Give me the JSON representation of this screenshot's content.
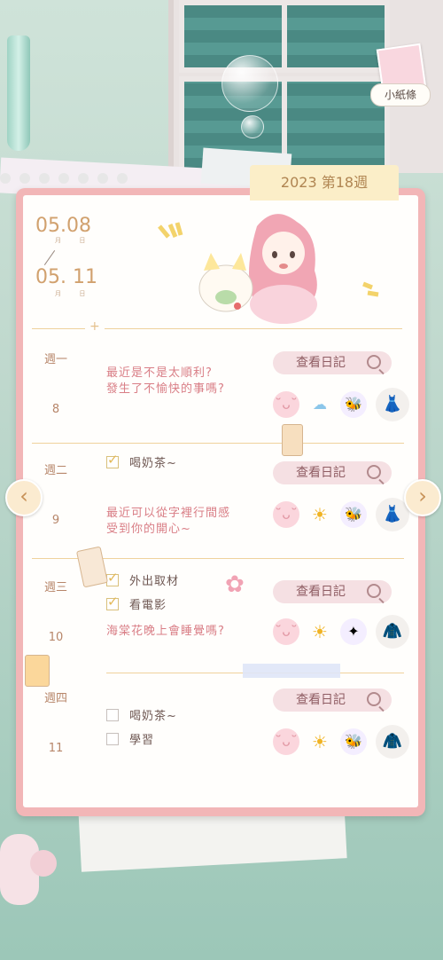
{
  "header": {
    "note_button_label": "小紙條"
  },
  "week_tab": "2023 第18週",
  "date_range": {
    "start_month": "05",
    "start_day": "08",
    "end_month": "05",
    "end_day": "11",
    "month_char": "月",
    "day_char": "日",
    "sep_mark": "+"
  },
  "diary_button_label": "查看日記",
  "days": [
    {
      "label": "週一",
      "num": "8",
      "note": [
        "最近是不是太順利?",
        "發生了不愉快的事嗎?"
      ],
      "todos": [],
      "icons": [
        "mood-face-icon",
        "cloud-icon",
        "bee-charm-icon",
        "outfit-dress-icon"
      ]
    },
    {
      "label": "週二",
      "num": "9",
      "note": [
        "最近可以從字裡行間感",
        "受到你的開心~"
      ],
      "todos": [
        {
          "text": "喝奶茶~",
          "checked": true
        }
      ],
      "icons": [
        "mood-face-icon",
        "sun-icon",
        "bee-charm-icon",
        "outfit-dress-icon"
      ]
    },
    {
      "label": "週三",
      "num": "10",
      "note": [
        "海棠花晚上會睡覺嗎?"
      ],
      "todos": [
        {
          "text": "外出取材",
          "checked": true
        },
        {
          "text": "看電影",
          "checked": true
        }
      ],
      "icons": [
        "mood-face-icon",
        "sun-icon",
        "charm-icon",
        "outfit-icon"
      ]
    },
    {
      "label": "週四",
      "num": "11",
      "note": [],
      "todos": [
        {
          "text": "喝奶茶~",
          "checked": false
        },
        {
          "text": "學習",
          "checked": false
        }
      ],
      "icons": [
        "mood-face-icon",
        "sun-icon",
        "bee-charm-icon",
        "outfit-jacket-icon"
      ]
    }
  ],
  "nav": {
    "prev": "‹",
    "next": "›"
  },
  "colors": {
    "accent": "#f2b6b7",
    "tab": "#fbeec8",
    "note_text": "#d97e86"
  }
}
